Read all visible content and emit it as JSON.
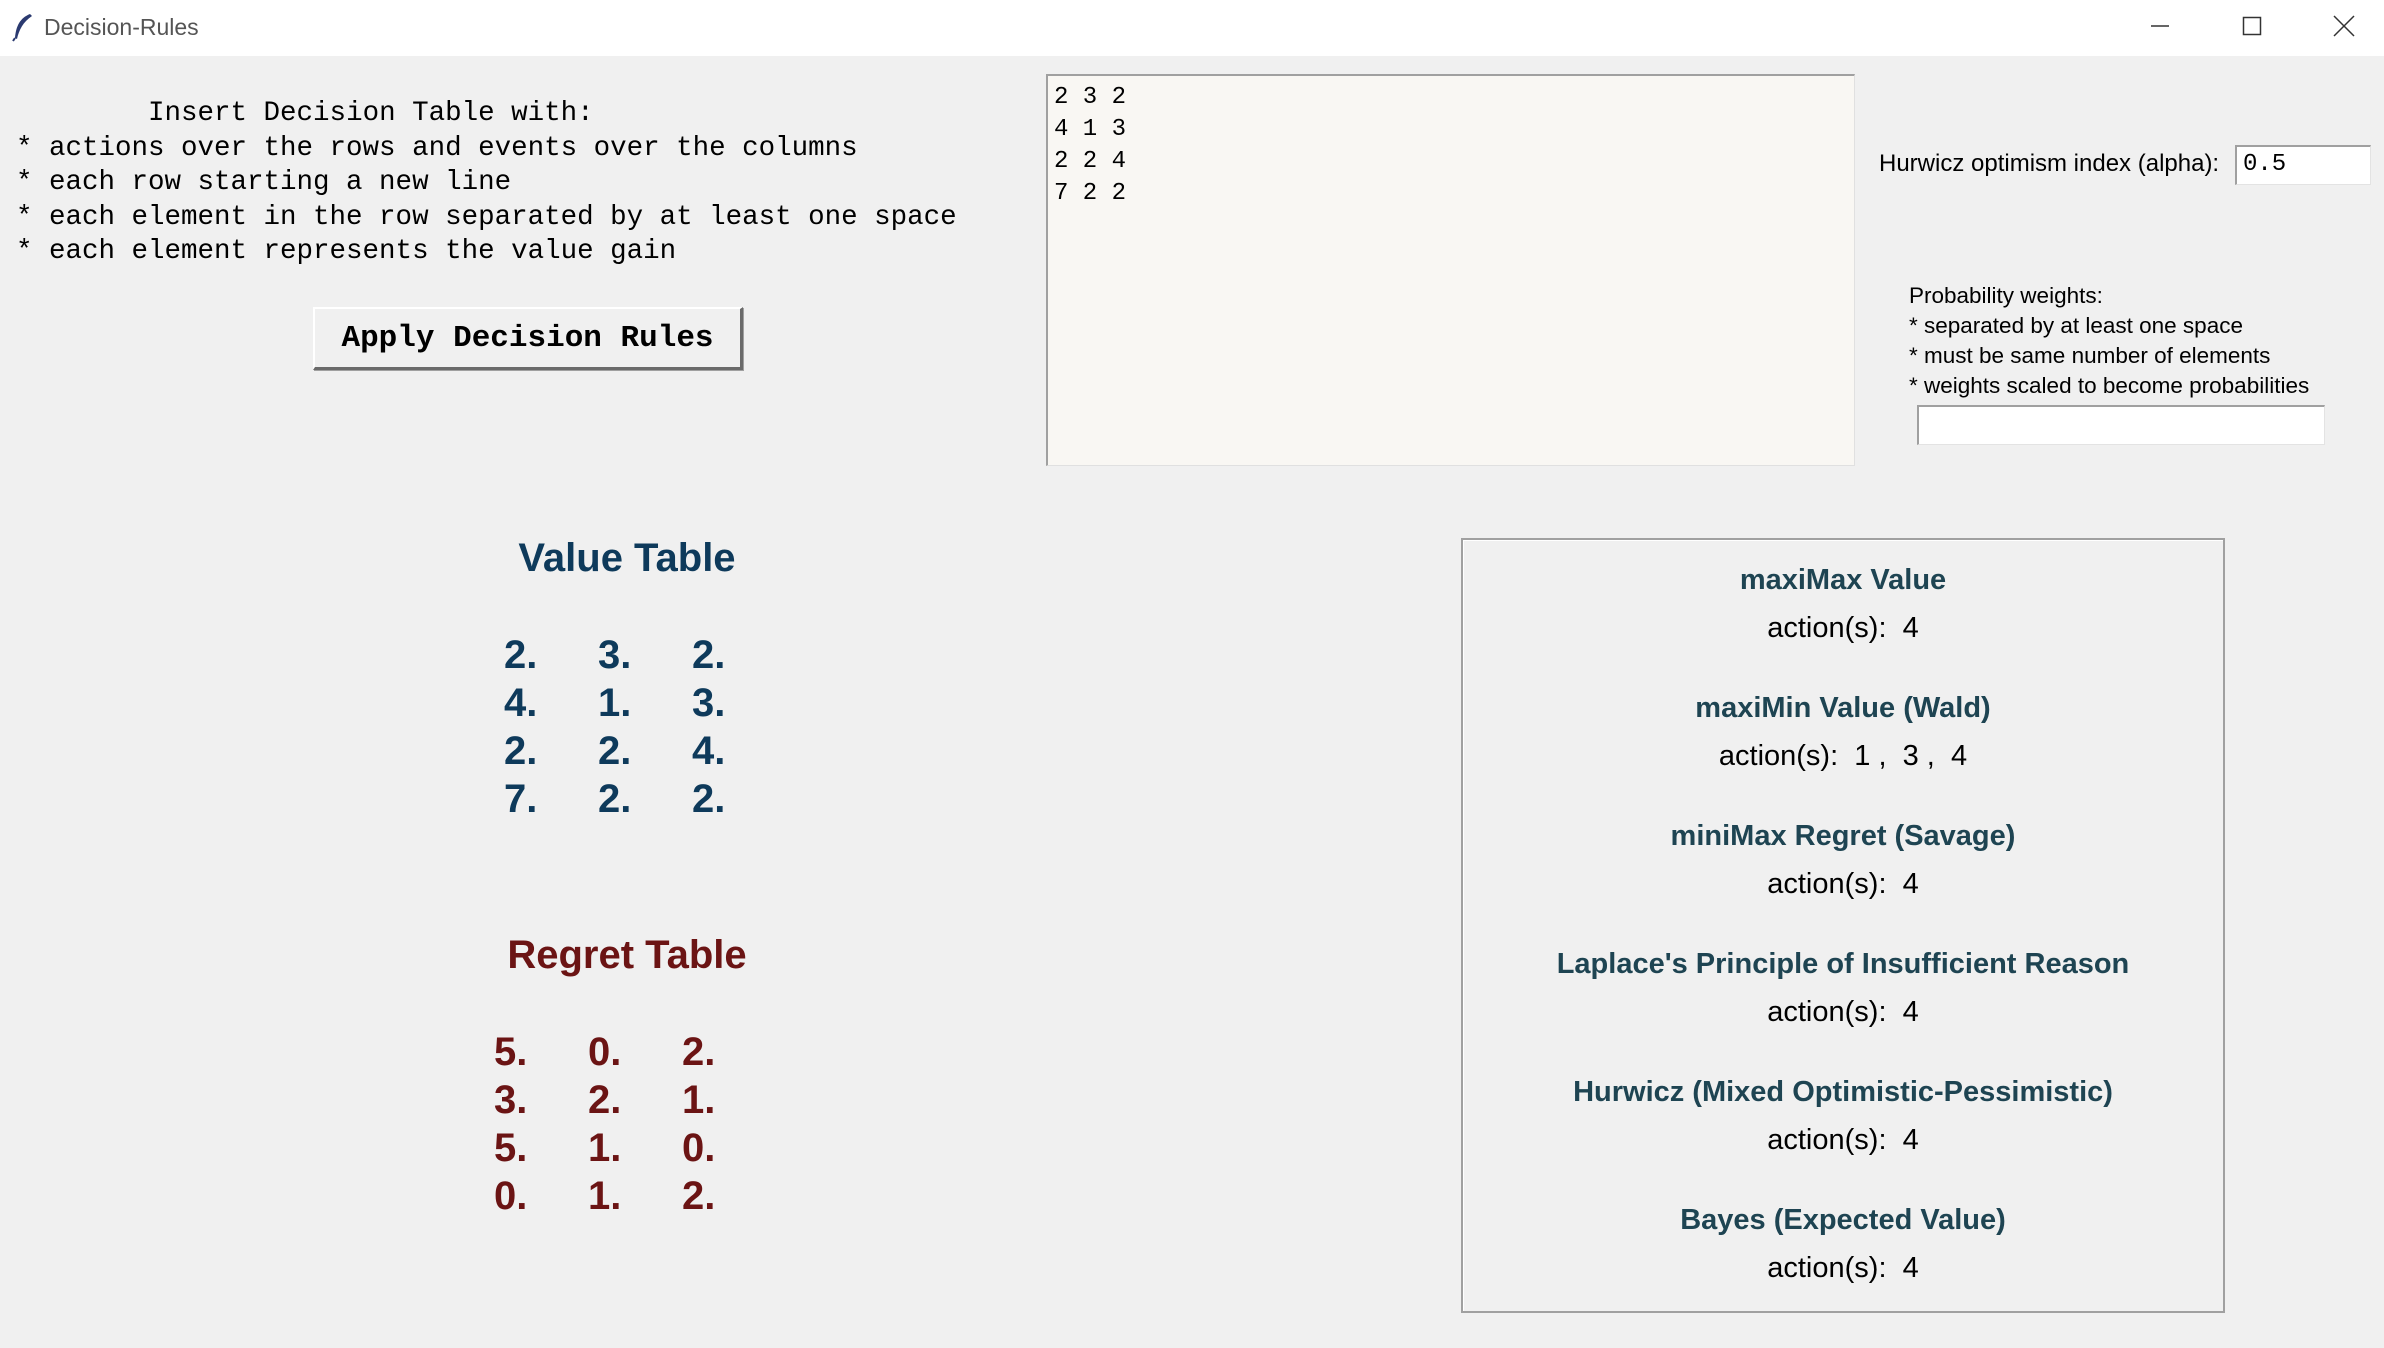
{
  "window": {
    "title": "Decision-Rules",
    "icon": "feather-icon",
    "controls": [
      "minimize-icon",
      "maximize-icon",
      "close-icon"
    ]
  },
  "instructions": {
    "title": "Insert Decision Table with:",
    "lines": [
      "* actions over the rows and events over the columns",
      "* each row starting a new line",
      "* each element in the row separated by at least one space",
      "* each element represents the value gain"
    ]
  },
  "apply_button": "Apply Decision Rules",
  "matrix_input": "2 3 2\n4 1 3\n2 2 4\n7 2 2",
  "hurwicz": {
    "label": "Hurwicz optimism index (alpha):",
    "value": "0.5"
  },
  "probability": {
    "lines": [
      "Probability weights:",
      "* separated by at least one space",
      "* must be same number of elements",
      "* weights scaled to become probabilities"
    ],
    "value": ""
  },
  "value_table": {
    "title": "Value Table",
    "rows": [
      [
        "2.",
        "3.",
        "2."
      ],
      [
        "4.",
        "1.",
        "3."
      ],
      [
        "2.",
        "2.",
        "4."
      ],
      [
        "7.",
        "2.",
        "2."
      ]
    ],
    "color": "#0e3a5b"
  },
  "regret_table": {
    "title": "Regret Table",
    "rows": [
      [
        "5.",
        "0.",
        "2."
      ],
      [
        "3.",
        "2.",
        "1."
      ],
      [
        "5.",
        "1.",
        "0."
      ],
      [
        "0.",
        "1.",
        "2."
      ]
    ],
    "color": "#6b1414"
  },
  "results": [
    {
      "heading": "maxiMax Value",
      "actions": "action(s):  4"
    },
    {
      "heading": "maxiMin Value (Wald)",
      "actions": "action(s):  1 ,  3 ,  4"
    },
    {
      "heading": "miniMax Regret (Savage)",
      "actions": "action(s):  4"
    },
    {
      "heading": "Laplace's Principle of Insufficient Reason",
      "actions": "action(s):  4"
    },
    {
      "heading": "Hurwicz (Mixed Optimistic-Pessimistic)",
      "actions": "action(s):  4"
    },
    {
      "heading": "Bayes (Expected Value)",
      "actions": "action(s):  4"
    }
  ]
}
